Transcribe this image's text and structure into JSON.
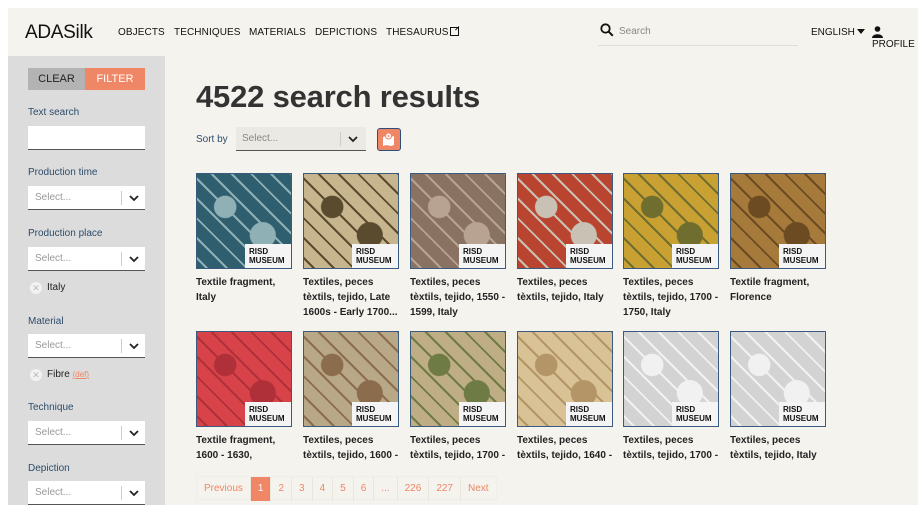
{
  "header": {
    "brand": "ADASilk",
    "nav": [
      "OBJECTS",
      "TECHNIQUES",
      "MATERIALS",
      "DEPICTIONS",
      "THESAURUS"
    ],
    "search_placeholder": "Search",
    "language": "ENGLISH",
    "profile": "PROFILE"
  },
  "sidebar": {
    "clear_label": "CLEAR",
    "filter_label": "FILTER",
    "text_search_label": "Text search",
    "production_time_label": "Production time",
    "production_place_label": "Production place",
    "production_place_chip": "Italy",
    "material_label": "Material",
    "material_chip": "Fibre",
    "material_chip_link": "def",
    "technique_label": "Technique",
    "depiction_label": "Depiction",
    "select_placeholder": "Select..."
  },
  "main": {
    "results_title": "4522 search results",
    "sort_label": "Sort by",
    "sort_placeholder": "Select...",
    "risd_line1": "RISD",
    "risd_line2": "MUSEUM",
    "results": [
      {
        "caption": "Textile fragment, Italy",
        "colors": [
          "#2f5e6e",
          "#8fb0b5"
        ]
      },
      {
        "caption": "Textiles, peces tèxtils, tejido, Late 1600s - Early 1700...",
        "colors": [
          "#c7b58e",
          "#5a4a2e"
        ]
      },
      {
        "caption": "Textiles, peces tèxtils, tejido, 1550 - 1599, Italy",
        "colors": [
          "#8a7262",
          "#b8a393"
        ]
      },
      {
        "caption": "Textiles, peces tèxtils, tejido, Italy",
        "colors": [
          "#b9442f",
          "#c9c2b4"
        ]
      },
      {
        "caption": "Textiles, peces tèxtils, tejido, 1700 - 1750, Italy",
        "colors": [
          "#c9a032",
          "#6f6e2f"
        ]
      },
      {
        "caption": "Textile fragment, Florence",
        "colors": [
          "#a57a3a",
          "#6d4b22"
        ]
      },
      {
        "caption": "Textile fragment, 1600 - 1630,",
        "colors": [
          "#d8434a",
          "#b0303a"
        ]
      },
      {
        "caption": "Textiles, peces tèxtils, tejido, 1600 -",
        "colors": [
          "#b8a888",
          "#8b6c4d"
        ]
      },
      {
        "caption": "Textiles, peces tèxtils, tejido, 1700 -",
        "colors": [
          "#bfae85",
          "#6f7b44"
        ]
      },
      {
        "caption": "Textiles, peces tèxtils, tejido, 1640 -",
        "colors": [
          "#d9c296",
          "#b49567"
        ]
      },
      {
        "caption": "Textiles, peces tèxtils, tejido, 1700 -",
        "colors": [
          "#d3d3d3",
          "#f1f1f1"
        ]
      },
      {
        "caption": "Textiles, peces tèxtils, tejido, Italy",
        "colors": [
          "#d3d3d3",
          "#f1f1f1"
        ]
      }
    ],
    "pagination": [
      "Previous",
      "1",
      "2",
      "3",
      "4",
      "5",
      "6",
      "...",
      "226",
      "227",
      "Next"
    ],
    "current_page": "1"
  }
}
